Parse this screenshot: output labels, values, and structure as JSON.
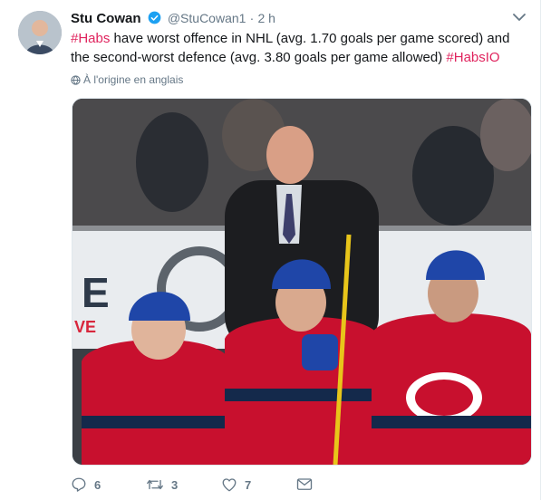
{
  "tweet": {
    "author_name": "Stu Cowan",
    "handle": "@StuCowan1",
    "separator": "·",
    "time": "2 h",
    "text_parts": {
      "tag1": "#Habs",
      "body": " have worst offence in NHL (avg. 1.70 goals per game scored) and the second-worst defence (avg. 3.80 goals per game allowed) ",
      "tag2": "#HabsIO"
    },
    "translate_label": "À l'origine en anglais",
    "photo_alt_icon": "photo",
    "actions": {
      "reply_count": "6",
      "retweet_count": "3",
      "like_count": "7"
    },
    "colors": {
      "hashtag": "#e0245e",
      "verified": "#1da1f2",
      "muted": "#657786"
    }
  }
}
